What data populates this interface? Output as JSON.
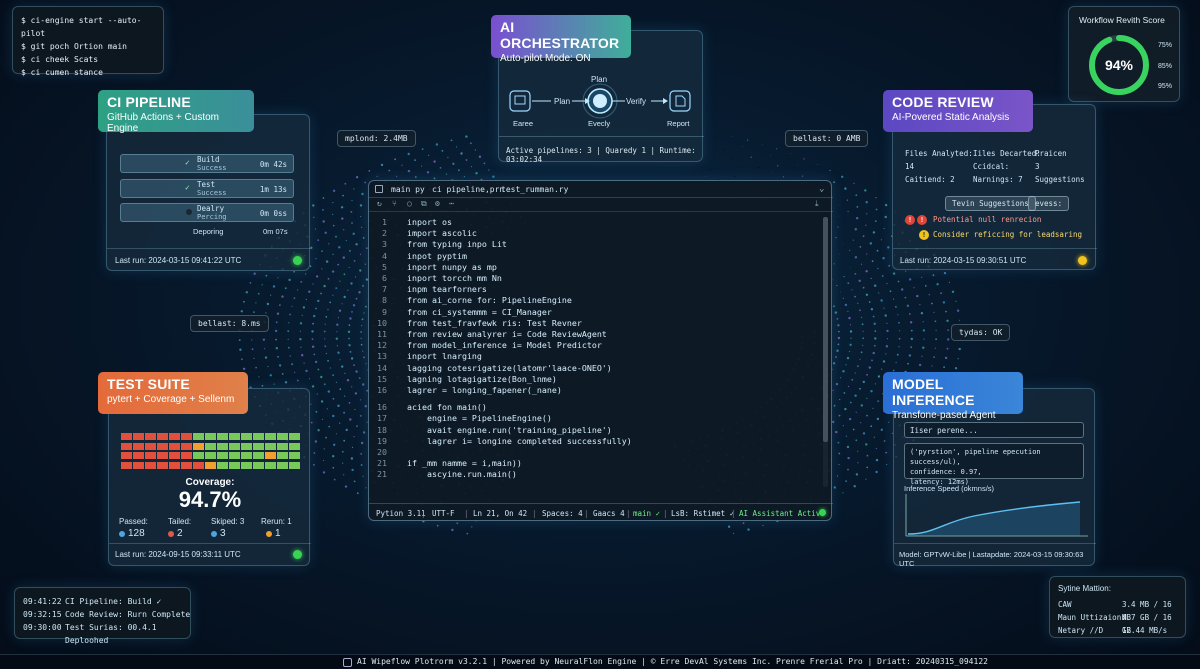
{
  "terminal": {
    "lines": [
      "$ ci-engine start --auto-pilot",
      "$ git poch Ortion main",
      "$ ci cheek Scats",
      "$ ci cumen stance"
    ]
  },
  "orchestrator": {
    "title": "AI ORCHESTRATOR",
    "subtitle": "Auto-pilot Mode: ON",
    "nodes": {
      "plan": "Plan",
      "left": "Earee",
      "center": "Evecly",
      "report": "Report",
      "arrow_plan": "Plan",
      "arrow_verify": "Verify"
    },
    "status": "Active pipelines: 3 | Quaredy 1 | Runtime: 03:02:34"
  },
  "score": {
    "title": "Workflow Revith Score",
    "value": "94%",
    "percent": 94,
    "levels": [
      "75%",
      "85%",
      "95%"
    ]
  },
  "ci": {
    "title": "CI PIPELINE",
    "subtitle": "GitHub Actions + Custom Engine",
    "rows": [
      {
        "name": "Build",
        "status": "Success",
        "time": "0m 42s",
        "icon": "check"
      },
      {
        "name": "Test",
        "status": "Success",
        "time": "1m 13s",
        "icon": "check"
      },
      {
        "name": "Dealry",
        "status": "Percing",
        "time": "0m 0ss",
        "icon": "pending"
      }
    ],
    "deploy_label": "Deporing",
    "deploy_time": "0m 07s",
    "last_run": "Last run: 2024-03-15 09:41:22 UTC"
  },
  "review": {
    "title": "CODE REVIEW",
    "subtitle": "AI-Povered Static Analysis",
    "stats": [
      [
        "Files Analyted:",
        "Iiles Decarted:",
        "Praicen"
      ],
      [
        "14",
        "Ccidcal:",
        "3"
      ],
      [
        "Caitiend: 2",
        "Narnings: 7",
        "Suggestions"
      ]
    ],
    "btn_suggestions": "Tevin Suggestions",
    "btn_evess": "evess:",
    "issue_error": "Potential null renrecion",
    "issue_warn": "Consider reficcing for leadsaring",
    "last_run": "Last run: 2024-03-15 09:30:51 UTC"
  },
  "badges": {
    "mplond": "mplond: 2.4MB",
    "bellast_right": "bellast: 0 AMB",
    "bellast_left": "bellast: 8.ms",
    "tydas": "tydas: OK"
  },
  "editor": {
    "tabs": [
      "main py",
      "ci pipeline,prn",
      "test_rumman.ry"
    ],
    "lines": [
      {
        "n": "1",
        "t": "inport os"
      },
      {
        "n": "2",
        "t": "import ascolic"
      },
      {
        "n": "3",
        "t": "from typing inpo Lit"
      },
      {
        "n": "4",
        "t": "inpot pyptim"
      },
      {
        "n": "5",
        "t": "inport nunpy as mp"
      },
      {
        "n": "6",
        "t": "inport torcch mm Nn"
      },
      {
        "n": "7",
        "t": "inpm tearforners"
      },
      {
        "n": "8",
        "t": "from ai_corne for: PipelineEngine"
      },
      {
        "n": "9",
        "t": "from ci_systemmm = CI_Manager"
      },
      {
        "n": "10",
        "t": "from test_fravfewk ris: Test Revner"
      },
      {
        "n": "11",
        "t": "from review analyrer i= Code ReviewAgent"
      },
      {
        "n": "12",
        "t": "from model_inference i= Model Predictor"
      },
      {
        "n": "13",
        "t": "inport lnarging"
      },
      {
        "n": "14",
        "t": "lagging cotesrigatize(latomr'laace-ONEO')"
      },
      {
        "n": "15",
        "t": "lagning lotagigatize(Bon_lnme)"
      },
      {
        "n": "16",
        "t": "lagrer = longing_fapener(_nane)"
      },
      {
        "n": "16",
        "t": "acied fon main()"
      },
      {
        "n": "17",
        "t": "    engine = PipelineEngine()"
      },
      {
        "n": "18",
        "t": "    avait engine.run('training_pipeline')"
      },
      {
        "n": "19",
        "t": "    lagrer i= longine completed successfully)"
      },
      {
        "n": "20",
        "t": ""
      },
      {
        "n": "21",
        "t": "if _mm namme = i,main))"
      },
      {
        "n": "21",
        "t": "    ascyine.run.main()"
      }
    ],
    "status": {
      "python": "Pytion 3.11",
      "encoding": "UTT-F",
      "position": "Ln 21, On 42",
      "spaces": "Spaces: 4",
      "gaacs": "Gaacs 4",
      "branch": "main ✓",
      "lsb": "LsB: Rstimet ✓",
      "assistant": "AI Assistant Active"
    }
  },
  "test": {
    "title": "TEST SUITE",
    "subtitle": "pytert + Coverage + Sellenm",
    "coverage_label": "Coverage:",
    "coverage": "94.7%",
    "heat": [
      [
        0,
        0,
        0,
        0,
        0,
        0,
        1,
        1,
        1,
        1,
        1,
        1,
        1,
        1,
        1
      ],
      [
        0,
        0,
        0,
        0,
        0,
        0,
        2,
        1,
        1,
        1,
        1,
        1,
        1,
        1,
        1
      ],
      [
        0,
        0,
        0,
        0,
        0,
        0,
        1,
        1,
        1,
        1,
        1,
        1,
        2,
        1,
        1
      ],
      [
        0,
        0,
        0,
        0,
        0,
        0,
        0,
        2,
        1,
        1,
        1,
        1,
        1,
        1,
        1
      ]
    ],
    "stats": [
      {
        "label": "Passed:",
        "value": "128",
        "color": "#4fa3e0"
      },
      {
        "label": "Tailed:",
        "value": "2",
        "color": "#e05a4a"
      },
      {
        "label": "Skiped: 3",
        "value": "3",
        "color": "#4fa3e0"
      },
      {
        "label": "Rerun: 1",
        "value": "1",
        "color": "#f0a030"
      }
    ],
    "last_run": "Last run: 2024-09-15 09:33:11 UTC"
  },
  "inference": {
    "title": "MODEL INFERENCE",
    "subtitle": "Transfone-pased Agent",
    "input": "Iiser perene...",
    "output_lines": [
      "('pyrstion', pipeline epecution success/ul),",
      "confidence: 0.97,",
      "latency: 12ms)"
    ],
    "speed_label": "Inference Speed (okmns/s)",
    "footer": "Model: GPTvW-Libe | Lastapdate: 2024-03-15 09:30:63 UTC"
  },
  "log": {
    "lines": [
      {
        "time": "09:41:22",
        "text": "CI Pipeline: Build ✓"
      },
      {
        "time": "09:32:15",
        "text": "Code Review: Rurn Complete"
      },
      {
        "time": "09:30:00",
        "text": "Test Surias: 00.4.1 Deploohed"
      }
    ]
  },
  "system": {
    "title": "Sytine Mattion:",
    "rows": [
      {
        "label": "CAW",
        "value": "3.4 MB / 16 MB"
      },
      {
        "label": "Maun Uttizaion:",
        "value": "4.7 GB / 16 GB"
      },
      {
        "label": "Netary //D",
        "value": "12.44 MB/s"
      }
    ]
  },
  "footer": {
    "text": "AI Wipeflow Plotrorm v3.2.1 | Powered by NeuralFlon Engine | © Erre DevAl Systems Inc. Prenre Frerial Pro | Driatt: 20240315_094122"
  },
  "colors": {
    "ci_tag": "#2f9f86",
    "review_tag": "#6a4fc4",
    "orch_tag": "#7a55c8",
    "test_tag": "#e46a3a",
    "infer_tag": "#2a6fd6",
    "ok": "#39d353",
    "warn": "#f2c31b",
    "err": "#e0453a"
  }
}
